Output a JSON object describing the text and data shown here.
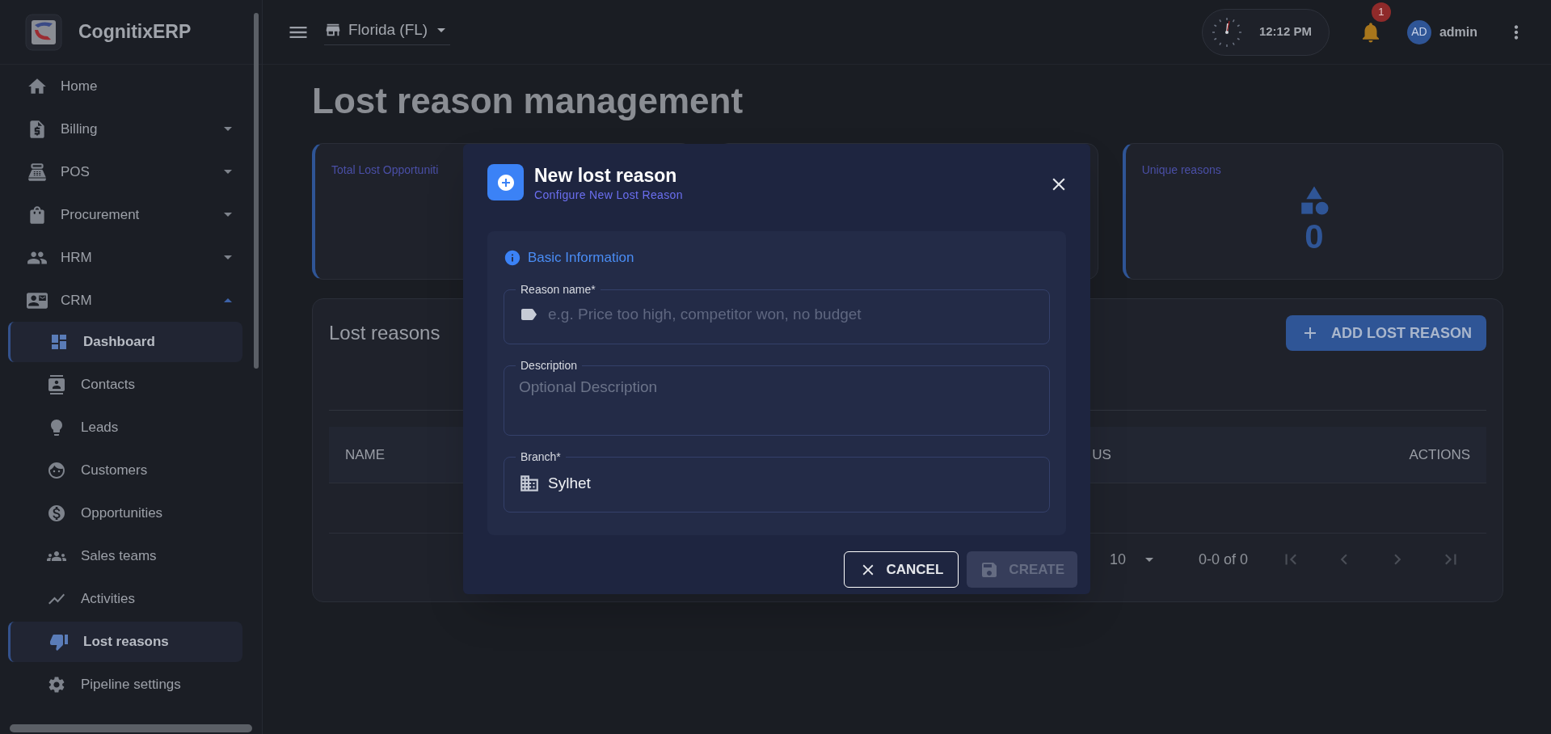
{
  "app": {
    "name": "CognitixERP"
  },
  "sidebar": {
    "items": [
      {
        "label": "Home",
        "kind": "link"
      },
      {
        "label": "Billing",
        "kind": "group",
        "expanded": false
      },
      {
        "label": "POS",
        "kind": "group",
        "expanded": false
      },
      {
        "label": "Procurement",
        "kind": "group",
        "expanded": false
      },
      {
        "label": "HRM",
        "kind": "group",
        "expanded": false
      },
      {
        "label": "CRM",
        "kind": "group",
        "expanded": true,
        "children": [
          {
            "label": "Dashboard",
            "selected": true
          },
          {
            "label": "Contacts",
            "selected": false
          },
          {
            "label": "Leads",
            "selected": false
          },
          {
            "label": "Customers",
            "selected": false
          },
          {
            "label": "Opportunities",
            "selected": false
          },
          {
            "label": "Sales teams",
            "selected": false
          },
          {
            "label": "Activities",
            "selected": false
          },
          {
            "label": "Lost reasons",
            "selected": true
          },
          {
            "label": "Pipeline settings",
            "selected": false
          }
        ]
      }
    ]
  },
  "topbar": {
    "branch": "Florida (FL)",
    "time": "12:12 PM",
    "notifications": "1",
    "avatar": "AD",
    "user": "admin"
  },
  "page": {
    "title": "Lost reason management"
  },
  "stats": [
    {
      "kind": "visible",
      "label": "Total Lost Opportuniti"
    },
    {
      "kind": "covered"
    },
    {
      "kind": "visible",
      "label": "Unique reasons",
      "value": "0"
    }
  ],
  "table_panel": {
    "title": "Lost reasons",
    "add_button": "ADD LOST REASON",
    "columns": [
      "NAME",
      "US",
      "ACTIONS"
    ],
    "rows_per_page": "10",
    "range": "0-0 of 0"
  },
  "dialog": {
    "title": "New lost reason",
    "subtitle": "Configure New Lost Reason",
    "section": "Basic Information",
    "fields": [
      {
        "kind": "text",
        "label": "Reason name*",
        "placeholder": "e.g. Price too high, competitor won, no budget"
      },
      {
        "kind": "textarea",
        "label": "Description",
        "placeholder": "Optional Description"
      },
      {
        "kind": "select",
        "label": "Branch*",
        "value": "Sylhet"
      }
    ],
    "buttons": [
      {
        "kind": "cancel",
        "label": "CANCEL",
        "disabled": false
      },
      {
        "kind": "save",
        "label": "CREATE",
        "disabled": true
      }
    ]
  }
}
